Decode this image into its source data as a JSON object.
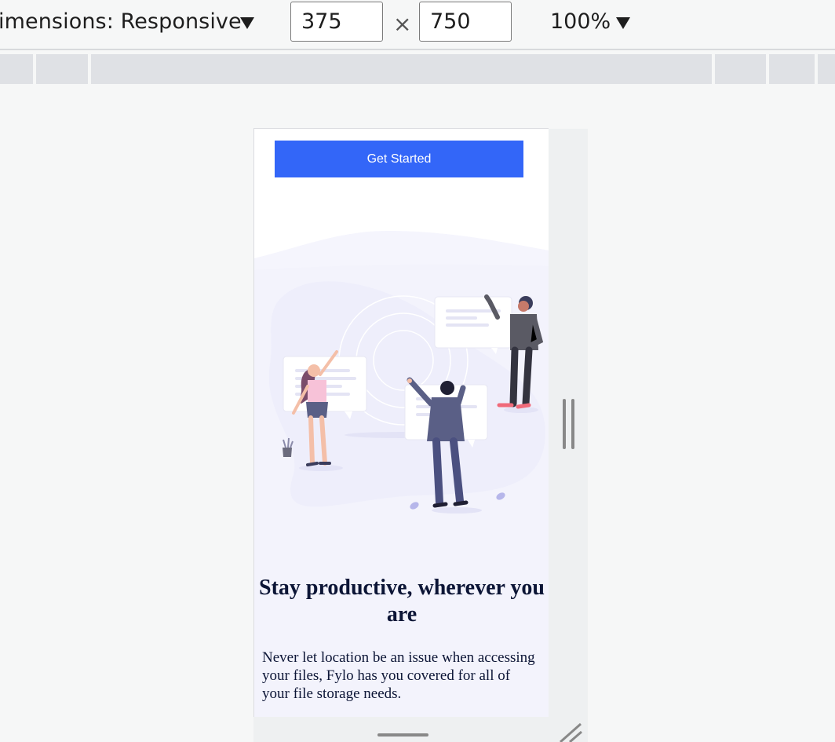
{
  "toolbar": {
    "dimensions_label": "imensions: Responsive",
    "width_value": "375",
    "height_value": "750",
    "times_symbol": "×",
    "zoom_label": "100%"
  },
  "page": {
    "cta_label": "Get Started",
    "headline": "Stay productive, wherever you are",
    "body": "Never let location be an issue when accessing your files, Fylo has you covered for all of your file storage needs."
  },
  "colors": {
    "accent": "#3366f8",
    "heading": "#0c1536",
    "hero_tint": "#f5f5fd"
  },
  "icons": {
    "dimensions_dropdown": "caret-down-icon",
    "zoom_dropdown": "caret-down-icon",
    "resize_corner": "resize-corner-icon"
  }
}
